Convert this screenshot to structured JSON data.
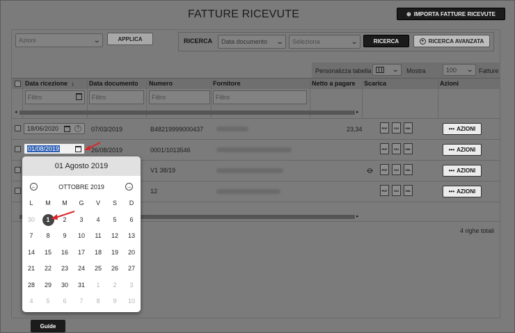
{
  "page": {
    "title": "FATTURE RICEVUTE"
  },
  "toolbar": {
    "import_label": "IMPORTA FATTURE RICEVUTE",
    "actions_placeholder": "Azioni",
    "apply_label": "APPLICA",
    "search_label": "RICERCA",
    "search_field_value": "Data documento",
    "search_value_placeholder": "Seleziona",
    "search_button": "RICERCA",
    "advanced_search_button": "RICERCA AVANZATA"
  },
  "table_controls": {
    "customize_label": "Personalizza tabella",
    "show_label": "Mostra",
    "page_size": "100",
    "unit_label": "Fatture"
  },
  "columns": [
    {
      "label": "Data ricezione"
    },
    {
      "label": "Data documento"
    },
    {
      "label": "Numero"
    },
    {
      "label": "Fornitore"
    },
    {
      "label": "Netto a pagare"
    },
    {
      "label": "Scarica"
    },
    {
      "label": "Azioni"
    }
  ],
  "filters": {
    "placeholder": "Filtro"
  },
  "rows": [
    {
      "data_ricezione": "18/06/2020",
      "data_documento": "07/03/2019",
      "numero": "B48219999000437",
      "netto": "23,34"
    },
    {
      "data_ricezione": "01/08/2019",
      "data_documento": "26/08/2019",
      "numero": "0001/1013546",
      "netto": ""
    },
    {
      "data_ricezione": "",
      "data_documento": "",
      "numero": "V1   38/19",
      "netto": ""
    },
    {
      "data_ricezione": "",
      "data_documento": "",
      "numero": "12",
      "netto": ""
    }
  ],
  "row_action_label": "AZIONI",
  "download_labels": {
    "pdf": "PDF",
    "sdi": "SDI",
    "xml": "XML"
  },
  "total_label": "4 righe totali",
  "calendar": {
    "selected_date": "01 Agosto 2019",
    "month_label": "OTTOBRE 2019",
    "weekdays": [
      "L",
      "M",
      "M",
      "G",
      "V",
      "S",
      "D"
    ],
    "weeks": [
      [
        "30",
        "1",
        "2",
        "3",
        "4",
        "5",
        "6"
      ],
      [
        "7",
        "8",
        "9",
        "10",
        "11",
        "12",
        "13"
      ],
      [
        "14",
        "15",
        "16",
        "17",
        "18",
        "19",
        "20"
      ],
      [
        "21",
        "22",
        "23",
        "24",
        "25",
        "26",
        "27"
      ],
      [
        "28",
        "29",
        "30",
        "31",
        "1",
        "2",
        "3"
      ],
      [
        "4",
        "5",
        "6",
        "7",
        "8",
        "9",
        "10"
      ]
    ]
  },
  "guide_label": "Guide",
  "colors": {
    "accent_red": "#d9262b",
    "selection_blue": "#2d5fb3"
  }
}
